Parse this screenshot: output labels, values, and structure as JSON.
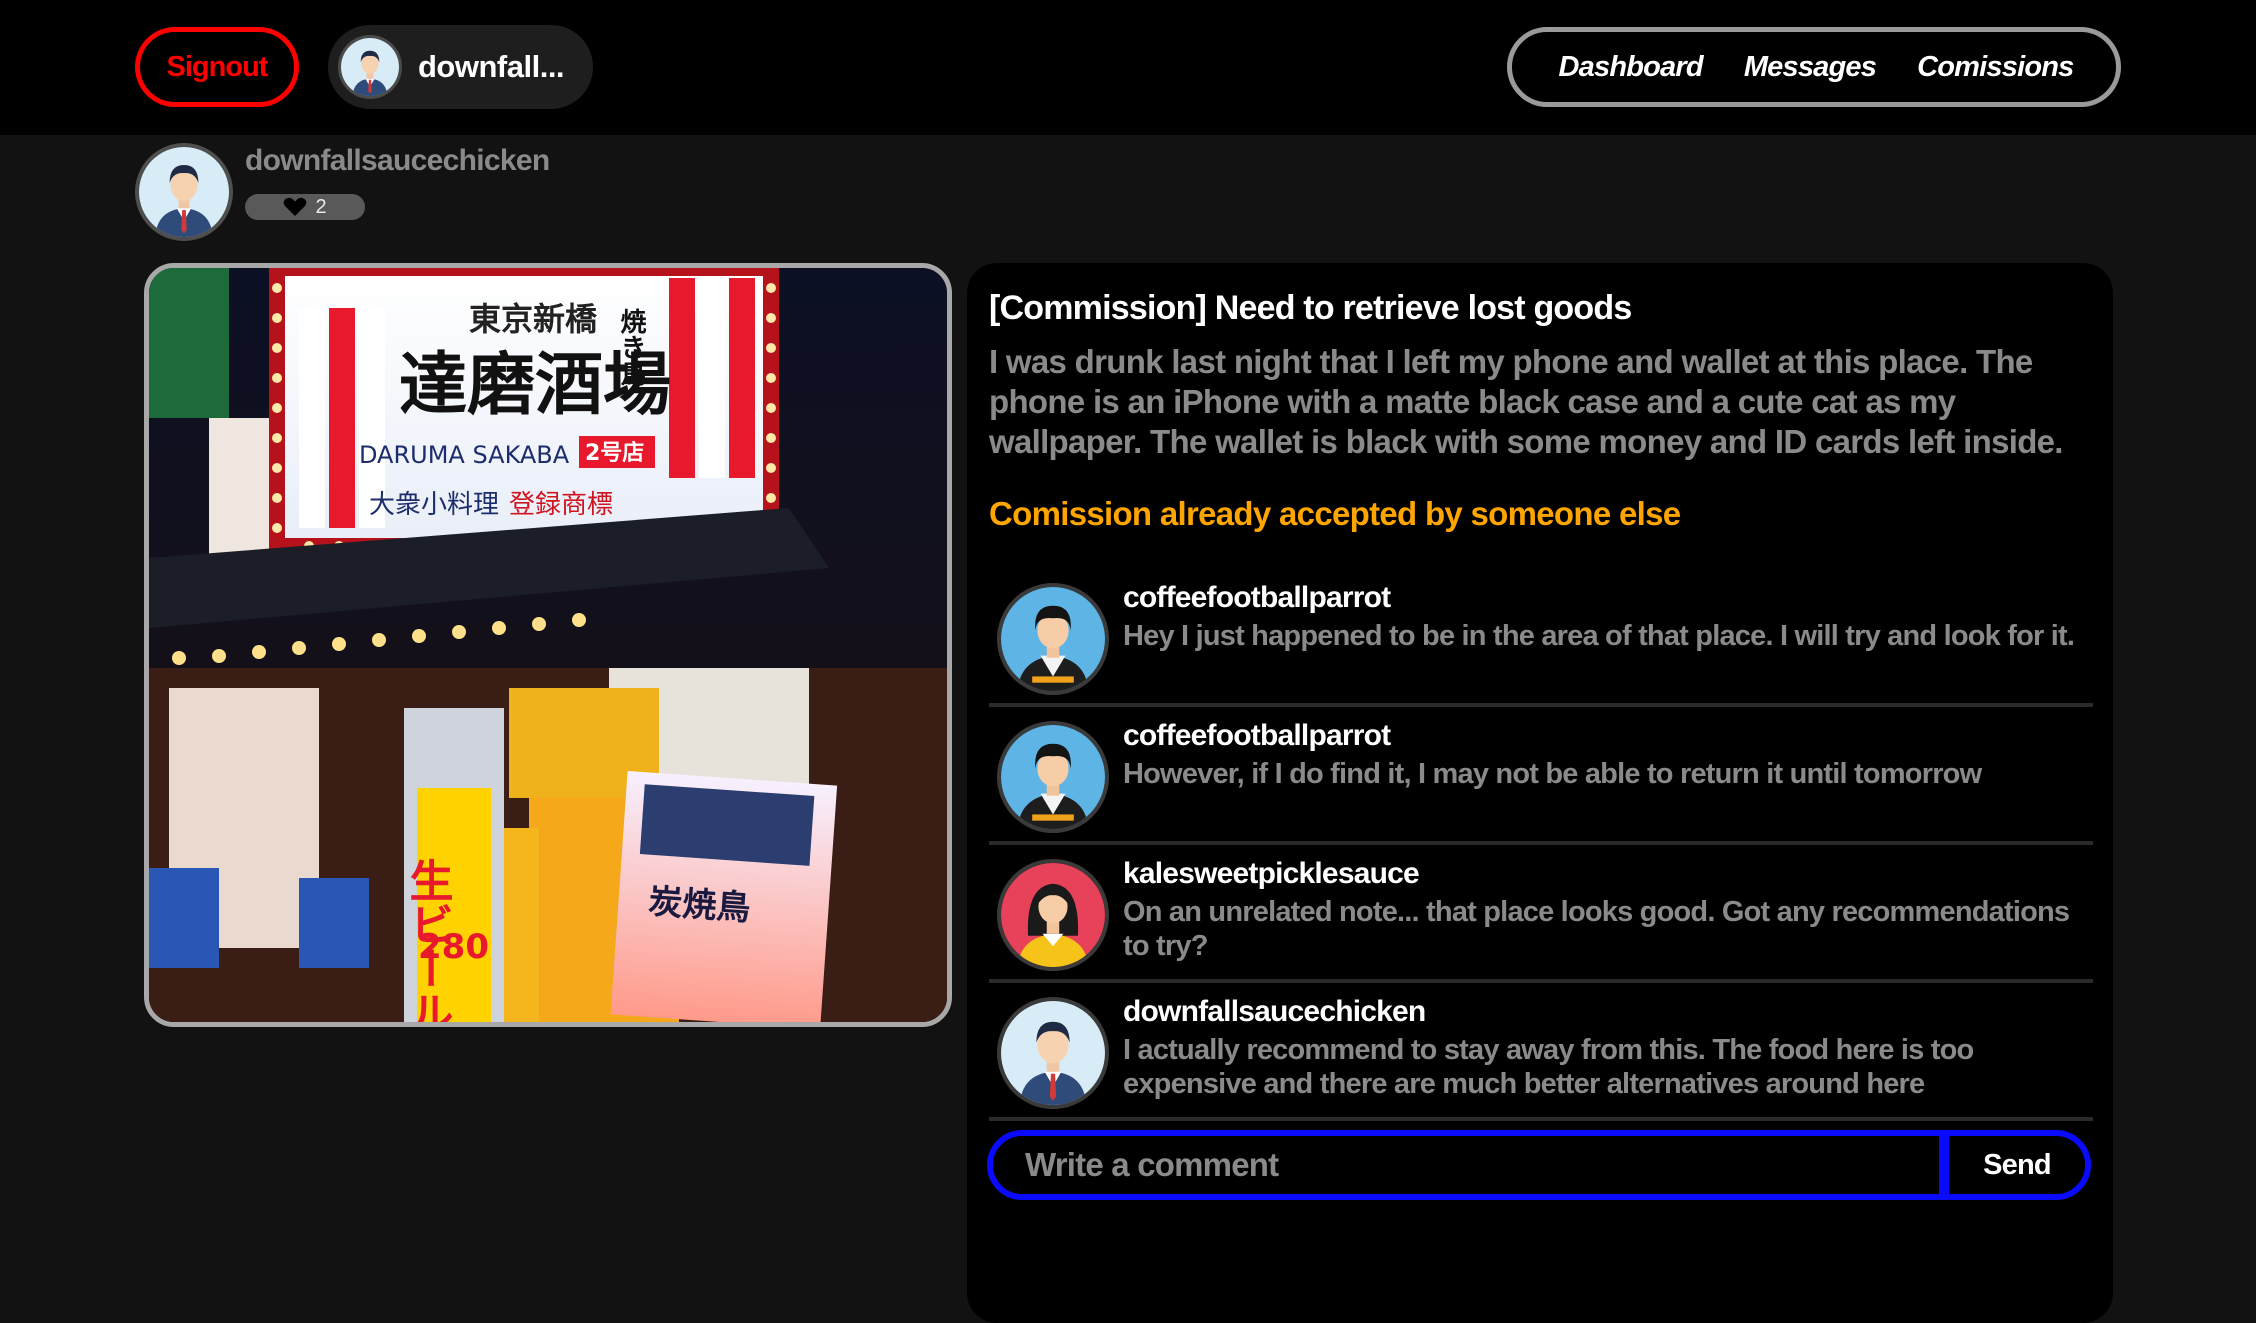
{
  "header": {
    "signout_label": "Signout",
    "current_user": {
      "display_name": "downfall..."
    },
    "nav": [
      {
        "label": "Dashboard"
      },
      {
        "label": "Messages"
      },
      {
        "label": "Comissions"
      }
    ]
  },
  "poster": {
    "username": "downfallsaucechicken",
    "likes": "2"
  },
  "commission": {
    "title": "[Commission] Need to retrieve lost goods",
    "description": "I was drunk last night that I left my phone and wallet at this place. The phone is an iPhone with a matte black case and a cute cat as my wallpaper. The wallet is black with some money and ID cards left inside.",
    "status": "Comission already accepted by someone else",
    "status_color": "#ffa500"
  },
  "photo_texts": {
    "sign_city": "東京新橋",
    "sign_main": "達磨酒場",
    "sign_romaji": "DARUMA SAKABA",
    "sign_branch": "2号店",
    "sign_sub1": "大衆小料理",
    "sign_sub2": "登録商標",
    "sign_side": "焼き鳥",
    "beer_sign": "生ビール",
    "beer_price": "280",
    "stand_sign": "炭焼鳥"
  },
  "comments": [
    {
      "user": "coffeefootballparrot",
      "avatar": "male-avatar-blue-icon",
      "text": "Hey I just happened to be in the area of that place. I will try and look for it."
    },
    {
      "user": "coffeefootballparrot",
      "avatar": "male-avatar-blue-icon",
      "text": "However, if I do find it, I may not be able to return it until tomorrow"
    },
    {
      "user": "kalesweetpicklesauce",
      "avatar": "female-avatar-red-icon",
      "text": "On an unrelated note... that place looks good. Got any recommendations to try?"
    },
    {
      "user": "downfallsaucechicken",
      "avatar": "businessman-avatar-icon",
      "text": "I actually recommend to stay away from this. The food here is too expensive and there are much better alternatives around here"
    }
  ],
  "comment_form": {
    "placeholder": "Write a comment",
    "send_label": "Send"
  },
  "colors": {
    "signout": "#ff0000",
    "comment_border": "#0a0aff",
    "background": "#121212"
  }
}
